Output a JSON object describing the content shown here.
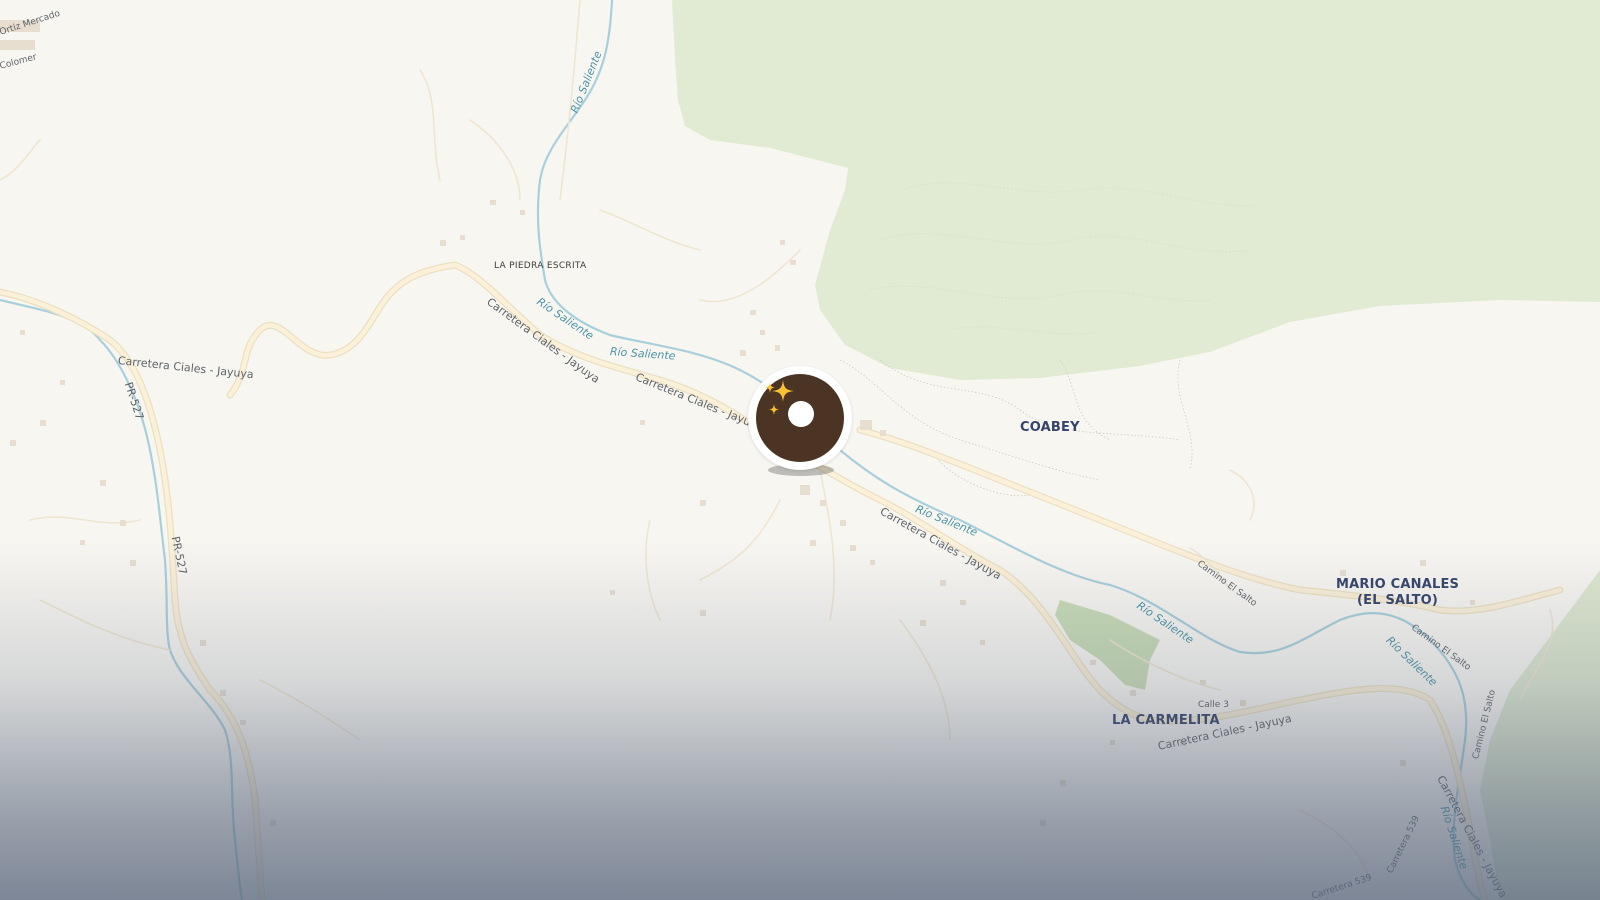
{
  "map": {
    "places": {
      "coabey": "COABEY",
      "mario_canales": "MARIO CANALES\n(EL SALTO)",
      "la_carmelita": "LA CARMELITA",
      "la_piedra_escrita": "LA PIEDRA ESCRITA"
    },
    "roads": {
      "carretera_ciales_jayuya": "Carretera Ciales - Jayuya",
      "carretera_ciales_jayuya_cut": "Carretera Ciales - Jayuy",
      "carretera_ciales_jayuya_cut2": "Carretera Ciales - Jayuya",
      "pr527": "PR-527",
      "camino_el_salto": "Camino El Salto",
      "calle_3": "Calle 3",
      "carretera_539": "Carretera 539",
      "carretera_539_short": "Carretera 539",
      "ortiz_mercado": "Ortiz Mercado",
      "colomer": "Colomer"
    },
    "rivers": {
      "rio_saliente": "Río Saliente"
    },
    "colors": {
      "land": "#f8f6f1",
      "forest": "#e1ebd4",
      "park": "#c9dcb6",
      "road": "#fbf0d8",
      "road_casing": "#ece0c2",
      "river": "#a8d0dc",
      "marker_fill": "#4b3424"
    },
    "marker": {
      "icon": "sparkles-icon",
      "type": "location-marker"
    }
  }
}
